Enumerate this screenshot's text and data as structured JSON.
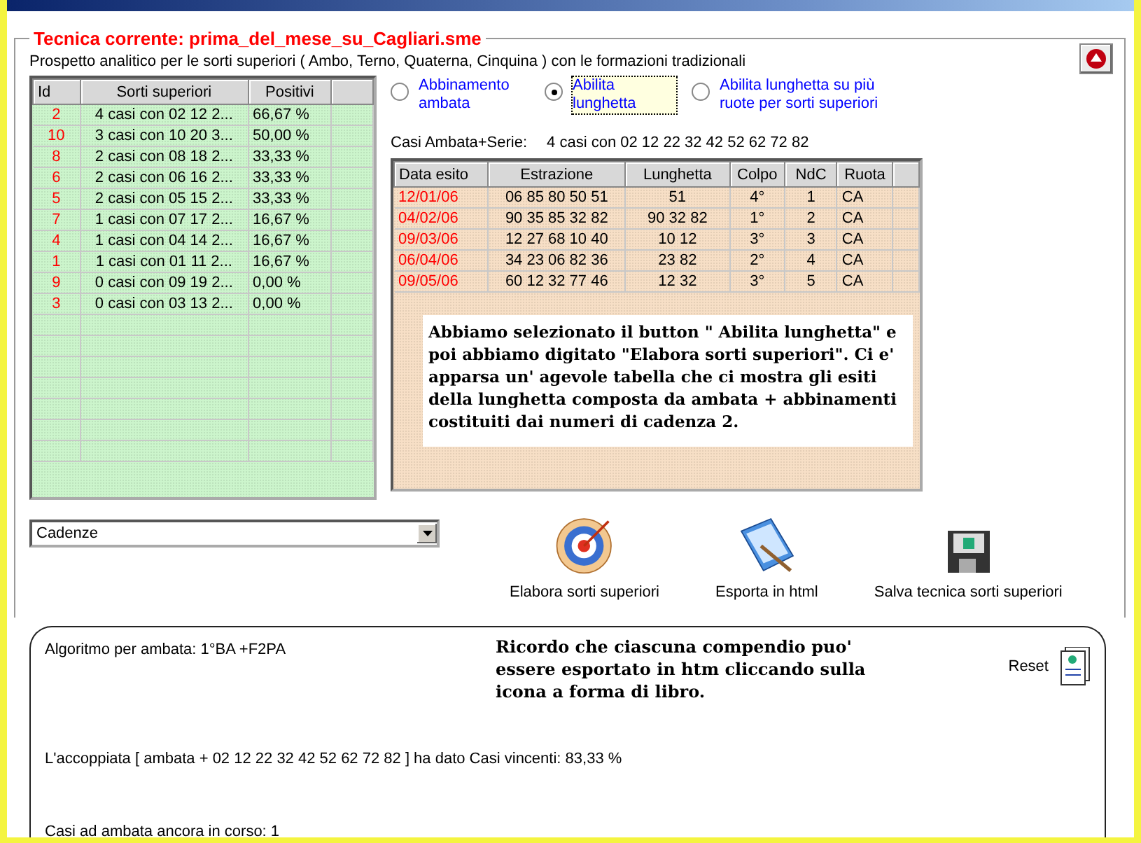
{
  "technique": {
    "legend": "Tecnica corrente: prima_del_mese_su_Cagliari.sme",
    "description": "Prospetto analitico per le sorti superiori ( Ambo, Terno, Quaterna, Cinquina ) con le formazioni tradizionali"
  },
  "sorti_table": {
    "columns": [
      "Id",
      "Sorti superiori",
      "Positivi"
    ],
    "rows": [
      {
        "id": "2",
        "sorte": "4 casi con 02 12 2...",
        "positivi": "66,67 %"
      },
      {
        "id": "10",
        "sorte": "3 casi con 10 20 3...",
        "positivi": "50,00 %"
      },
      {
        "id": "8",
        "sorte": "2 casi con 08 18 2...",
        "positivi": "33,33 %"
      },
      {
        "id": "6",
        "sorte": "2 casi con 06 16 2...",
        "positivi": "33,33 %"
      },
      {
        "id": "5",
        "sorte": "2 casi con 05 15 2...",
        "positivi": "33,33 %"
      },
      {
        "id": "7",
        "sorte": "1 casi con 07 17 2...",
        "positivi": "16,67 %"
      },
      {
        "id": "4",
        "sorte": "1 casi con 04 14 2...",
        "positivi": "16,67 %"
      },
      {
        "id": "1",
        "sorte": "1 casi con 01 11 2...",
        "positivi": "16,67 %"
      },
      {
        "id": "9",
        "sorte": "0 casi con 09 19 2...",
        "positivi": "0,00 %"
      },
      {
        "id": "3",
        "sorte": "0 casi con 03 13 2...",
        "positivi": "0,00 %"
      }
    ]
  },
  "options": [
    {
      "label": "Abbinamento ambata",
      "selected": false
    },
    {
      "label": "Abilita lunghetta",
      "selected": true
    },
    {
      "label": "Abilita lunghetta su più ruote per sorti superiori",
      "selected": false
    }
  ],
  "series": {
    "label": "Casi Ambata+Serie:",
    "value": "4 casi con 02 12 22 32 42 52 62 72 82"
  },
  "esiti_table": {
    "columns": [
      "Data esito",
      "Estrazione",
      "Lunghetta",
      "Colpo",
      "NdC",
      "Ruota"
    ],
    "rows": [
      [
        "12/01/06",
        "06 85 80 50 51",
        "51",
        "4°",
        "1",
        "CA"
      ],
      [
        "04/02/06",
        "90 35 85 32 82",
        "90 32 82",
        "1°",
        "2",
        "CA"
      ],
      [
        "09/03/06",
        "12 27 68 10 40",
        "10 12",
        "3°",
        "3",
        "CA"
      ],
      [
        "06/04/06",
        "34 23 06 82 36",
        "23 82",
        "2°",
        "4",
        "CA"
      ],
      [
        "09/05/06",
        "60 12 32 77 46",
        "12 32",
        "3°",
        "5",
        "CA"
      ]
    ]
  },
  "note_1": "Abbiamo selezionato il button \" Abilita lunghetta\" e poi abbiamo digitato \"Elabora sorti superiori\". Ci e' apparsa un' agevole tabella che ci mostra gli esiti della lunghetta composta da ambata + abbinamenti costituiti dai numeri di cadenza 2.",
  "dropdown": {
    "value": "Cadenze"
  },
  "actions": [
    {
      "kind": "target",
      "label": "Elabora sorti superiori"
    },
    {
      "kind": "book",
      "label": "Esporta in html"
    },
    {
      "kind": "floppy",
      "label": "Salva tecnica sorti superiori"
    }
  ],
  "result": {
    "algorithm": "Algoritmo per ambata: 1°BA +F2PA",
    "reset": "Reset",
    "note": "Ricordo che ciascuna compendio puo' essere esportato in htm cliccando sulla icona a forma di libro.",
    "lines": [
      "L'accoppiata [ ambata + 02 12 22 32 42 52 62 72 82 ] ha dato  Casi vincenti: 83,33 %",
      "Casi ad ambata ancora in corso:  1"
    ]
  }
}
